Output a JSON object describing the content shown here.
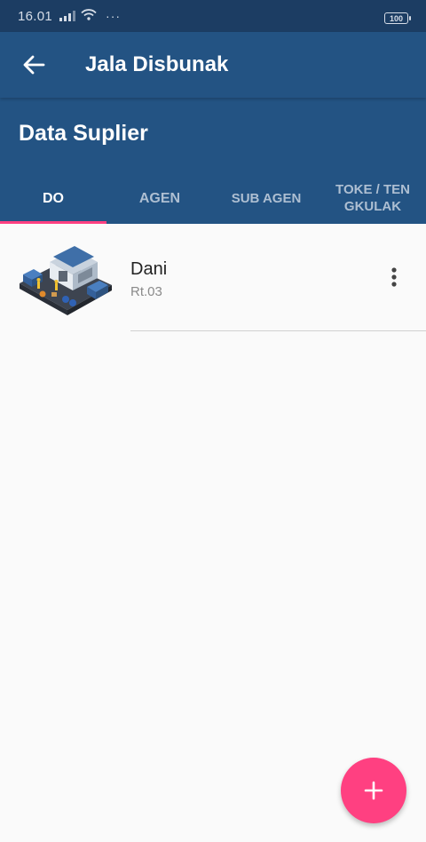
{
  "status_bar": {
    "time": "16.01",
    "more_indicator": "···",
    "battery": "100"
  },
  "app_bar": {
    "title": "Jala Disbunak",
    "back_icon": "arrow-left-icon"
  },
  "page": {
    "title": "Data Suplier"
  },
  "tabs": [
    {
      "label": "DO",
      "active": true
    },
    {
      "label": "AGEN",
      "active": false
    },
    {
      "label": "SUB AGEN",
      "active": false
    },
    {
      "label": "TOKE / TENGKULAK",
      "line1": "TOKE / TEN",
      "line2": "GKULAK",
      "active": false
    }
  ],
  "list": {
    "items": [
      {
        "name": "Dani",
        "subtitle": "Rt.03",
        "thumbnail": "warehouse-illustration",
        "menu_icon": "more-vertical-icon"
      }
    ]
  },
  "fab": {
    "icon": "plus-icon"
  },
  "colors": {
    "status_bar": "#1c3d63",
    "primary": "#235383",
    "accent": "#ff4081",
    "tab_inactive": "#aebfd2",
    "background": "#fafafa"
  }
}
